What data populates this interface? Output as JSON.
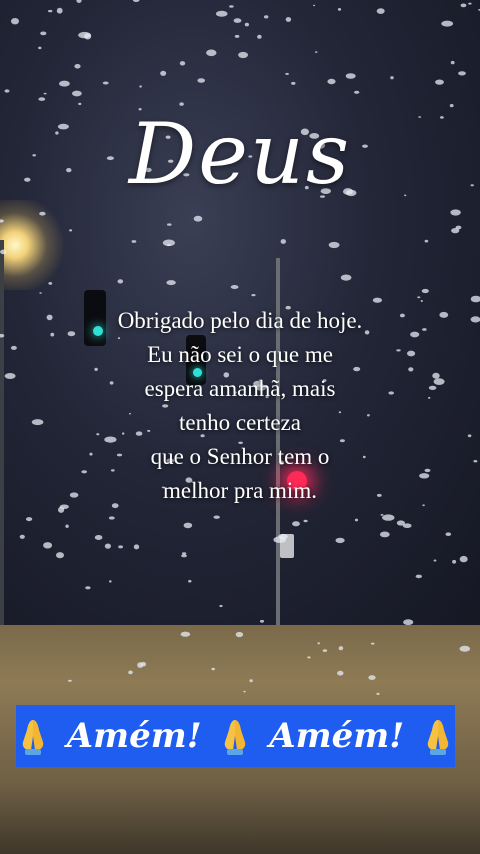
{
  "title": "Deus",
  "message_lines": [
    "Obrigado pelo dia de hoje.",
    "Eu não sei o que me",
    "espera amanhã, mais",
    "tenho certeza",
    "que o Senhor tem o",
    "melhor pra mim."
  ],
  "banner": {
    "items": [
      "Amém!",
      "Amém!"
    ],
    "icon": "folded-hands-icon",
    "background_color": "#1f5cf0"
  },
  "scene": {
    "description_colors": {
      "traffic_light_red": "#ff2a55",
      "traffic_light_teal": "#2fe0d6"
    }
  }
}
